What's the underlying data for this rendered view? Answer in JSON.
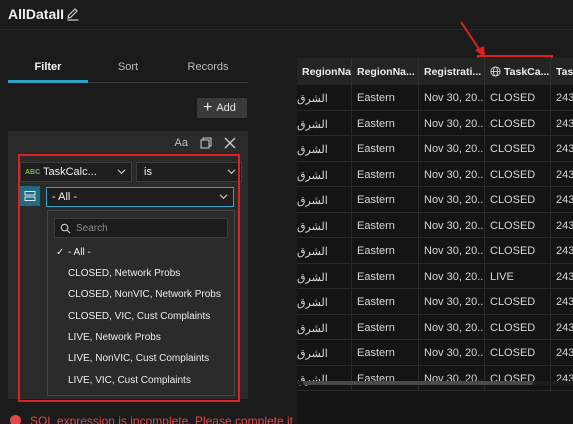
{
  "app": {
    "title": "AllDataII"
  },
  "tabs": [
    {
      "label": "Filter"
    },
    {
      "label": "Sort"
    },
    {
      "label": "Records"
    }
  ],
  "toolbar": {
    "add_label": "Add"
  },
  "clause": {
    "case_label": "Aa",
    "field": {
      "badge": "ABC",
      "label": "TaskCalc..."
    },
    "operator": {
      "label": "is"
    },
    "value": {
      "label": "- All -"
    }
  },
  "dropdown": {
    "search_placeholder": "Search",
    "selected_check": "✓",
    "items": [
      {
        "label": "- All -"
      },
      {
        "label": "CLOSED, Network Probs"
      },
      {
        "label": "CLOSED, NonVIC, Network Probs"
      },
      {
        "label": "CLOSED, VIC, Cust Complaints"
      },
      {
        "label": "LIVE, Network Probs"
      },
      {
        "label": "LIVE, NonVIC, Cust Complaints"
      },
      {
        "label": "LIVE, VIC, Cust Complaints"
      }
    ]
  },
  "error": {
    "message": "SQL expression is incomplete. Please complete it first."
  },
  "table": {
    "columns": [
      {
        "label": "RegionNa..."
      },
      {
        "label": "RegionNa..."
      },
      {
        "label": "Registrati..."
      },
      {
        "label": "TaskCa..."
      },
      {
        "label": "Task"
      }
    ],
    "rows": [
      [
        "الشرق",
        "Eastern",
        "Nov 30, 20...",
        "CLOSED",
        "243"
      ],
      [
        "الشرق",
        "Eastern",
        "Nov 30, 20...",
        "CLOSED",
        "243"
      ],
      [
        "الشرق",
        "Eastern",
        "Nov 30, 20...",
        "CLOSED",
        "243"
      ],
      [
        "الشرق",
        "Eastern",
        "Nov 30, 20...",
        "CLOSED",
        "243"
      ],
      [
        "الشرق",
        "Eastern",
        "Nov 30, 20...",
        "CLOSED",
        "243"
      ],
      [
        "الشرق",
        "Eastern",
        "Nov 30, 20...",
        "CLOSED",
        "243"
      ],
      [
        "الشرق",
        "Eastern",
        "Nov 30, 20...",
        "CLOSED",
        "243"
      ],
      [
        "الشرق",
        "Eastern",
        "Nov 30, 20...",
        "LIVE",
        "243"
      ],
      [
        "الشرق",
        "Eastern",
        "Nov 30, 20...",
        "CLOSED",
        "243"
      ],
      [
        "الشرق",
        "Eastern",
        "Nov 30, 20...",
        "CLOSED",
        "243"
      ],
      [
        "الشرق",
        "Eastern",
        "Nov 30, 20...",
        "CLOSED",
        "243"
      ],
      [
        "الشرق",
        "Eastern",
        "Nov 30, 20...",
        "CLOSED",
        "243"
      ]
    ]
  },
  "colors": {
    "accent": "#2fa3c8",
    "annotation": "#e02020",
    "error": "#e04848"
  }
}
